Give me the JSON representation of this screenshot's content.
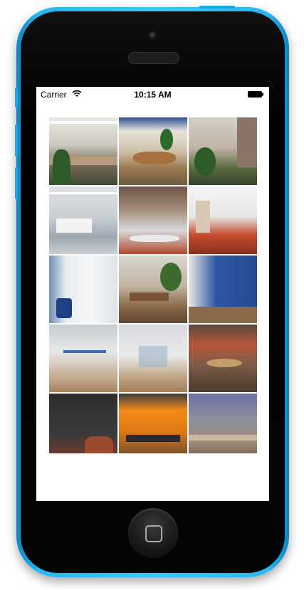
{
  "status_bar": {
    "carrier": "Carrier",
    "time": "10:15 AM"
  },
  "icons": {
    "wifi": "wifi-icon",
    "battery": "battery-icon",
    "home": "home-button-icon",
    "camera": "front-camera-icon"
  },
  "colors": {
    "device_body": "#3cc6f7",
    "screen_background": "#ffffff"
  },
  "gallery": {
    "photos": [
      {
        "subject": "open-office-desks"
      },
      {
        "subject": "lounge-wood-floor"
      },
      {
        "subject": "office-plants"
      },
      {
        "subject": "white-office-desks"
      },
      {
        "subject": "library-glass-wall"
      },
      {
        "subject": "meeting-room-red-carpet"
      },
      {
        "subject": "office-blue-chairs"
      },
      {
        "subject": "reception-table-tree"
      },
      {
        "subject": "blue-wall-corridor"
      },
      {
        "subject": "glass-wall-lettering"
      },
      {
        "subject": "glass-meeting-room"
      },
      {
        "subject": "cafeteria-red-chairs"
      },
      {
        "subject": "chalkboard-wall"
      },
      {
        "subject": "orange-kitchen-bar"
      },
      {
        "subject": "stairs-lounge"
      }
    ]
  }
}
